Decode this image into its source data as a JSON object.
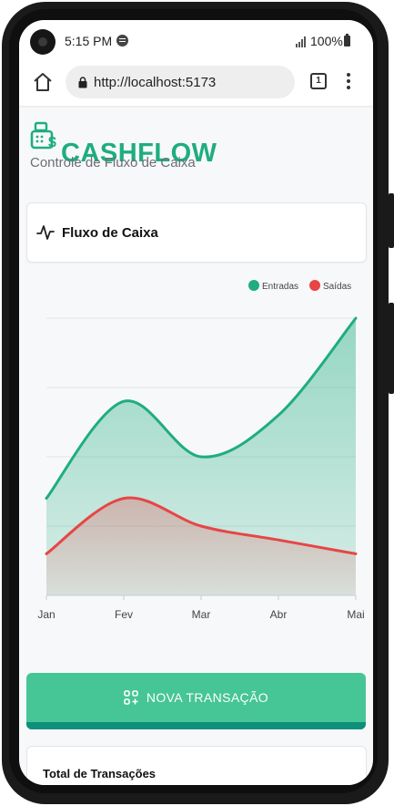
{
  "status_bar": {
    "time": "5:15 PM",
    "battery": "100%"
  },
  "browser": {
    "url": "http://localhost:5173",
    "tab_count": "1"
  },
  "app": {
    "brand": "CASHFLOW",
    "subtitle": "Controle de Fluxo de Caixa"
  },
  "chart_card": {
    "title": "Fluxo de Caixa"
  },
  "chart_data": {
    "type": "area",
    "categories": [
      "Jan",
      "Fev",
      "Mar",
      "Abr",
      "Mai"
    ],
    "series": [
      {
        "name": "Entradas",
        "color": "#1fad7f",
        "values": [
          140,
          280,
          200,
          260,
          400
        ]
      },
      {
        "name": "Saídas",
        "color": "#e84545",
        "values": [
          60,
          140,
          100,
          80,
          60
        ]
      }
    ],
    "ylim": [
      0,
      400
    ],
    "grid": true,
    "legend_position": "top-right"
  },
  "actions": {
    "new_transaction": "NOVA TRANSAÇÃO"
  },
  "summary": {
    "total_title": "Total de Transações"
  },
  "colors": {
    "accent": "#1fad7f",
    "button": "#46c596",
    "button_base": "#0e8f7a",
    "expense": "#e84545"
  }
}
